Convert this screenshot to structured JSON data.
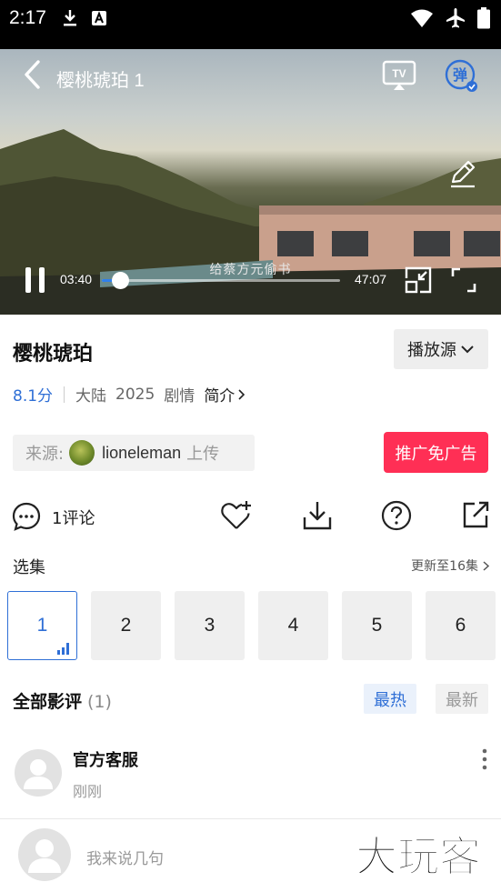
{
  "status_bar": {
    "time": "2:17",
    "left_icons": [
      "download-icon",
      "a-letter-icon"
    ],
    "right_icons": [
      "wifi-icon",
      "airplane-icon",
      "battery-icon"
    ]
  },
  "player": {
    "title": "樱桃琥珀 1",
    "subtitle": "给蔡方元偷书",
    "current_time": "03:40",
    "total_time": "47:07",
    "progress": 0.078,
    "danmu_label": "弹"
  },
  "info": {
    "title": "樱桃琥珀",
    "source_label": "播放源",
    "score": "8.1分",
    "region": "大陆",
    "year": "2025",
    "genre": "剧情",
    "intro_label": "简介"
  },
  "uploader": {
    "prefix": "来源:",
    "name": "lioneleman",
    "suffix": "上传"
  },
  "promo_label": "推广免广告",
  "actions": {
    "comments_label": "1评论"
  },
  "episodes": {
    "label": "选集",
    "update_text": "更新至16集",
    "items": [
      "1",
      "2",
      "3",
      "4",
      "5",
      "6"
    ],
    "active_index": 0
  },
  "reviews": {
    "label": "全部影评",
    "count": "(1)",
    "sort_hot": "最热",
    "sort_new": "最新",
    "items": [
      {
        "name": "官方客服",
        "time": "刚刚"
      }
    ]
  },
  "bottom": {
    "input_placeholder": "我来说几句",
    "watermark": "大玩客"
  },
  "colors": {
    "accent": "#2f6fd6",
    "promo": "#ff2f55"
  }
}
